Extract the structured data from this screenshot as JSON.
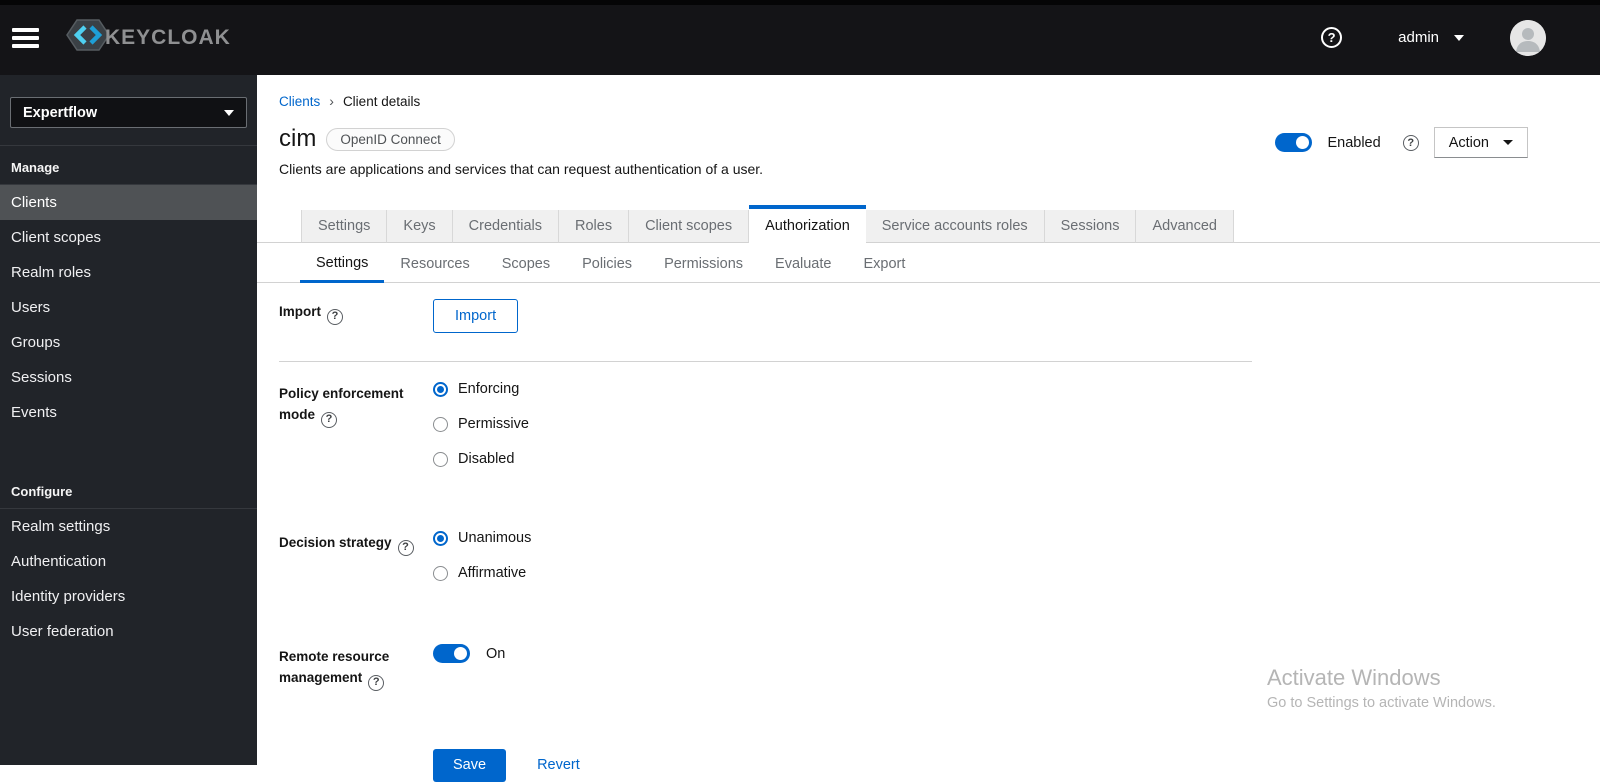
{
  "theme": {
    "accent": "#0066cc",
    "topbar_bg": "#141417",
    "sidebar_bg": "#212429",
    "sidebar_selected_bg": "#4f5255",
    "tab_inactive_bg": "#f0f0f0",
    "logo_cyan": "#4fd0f0",
    "logo_blue": "#1e9fd6"
  },
  "topbar": {
    "brand": "KEYCLOAK",
    "user": "admin"
  },
  "sidebar": {
    "realm_selector": {
      "value": "Expertflow"
    },
    "sections": [
      {
        "title": "Manage",
        "items": [
          {
            "label": "Clients",
            "active": true
          },
          {
            "label": "Client scopes",
            "active": false
          },
          {
            "label": "Realm roles",
            "active": false
          },
          {
            "label": "Users",
            "active": false
          },
          {
            "label": "Groups",
            "active": false
          },
          {
            "label": "Sessions",
            "active": false
          },
          {
            "label": "Events",
            "active": false
          }
        ]
      },
      {
        "title": "Configure",
        "items": [
          {
            "label": "Realm settings",
            "active": false
          },
          {
            "label": "Authentication",
            "active": false
          },
          {
            "label": "Identity providers",
            "active": false
          },
          {
            "label": "User federation",
            "active": false
          }
        ]
      }
    ]
  },
  "breadcrumb": {
    "items": [
      {
        "label": "Clients"
      },
      {
        "label": "Client details"
      }
    ]
  },
  "header": {
    "title": "cim",
    "badge": "OpenID Connect",
    "description": "Clients are applications and services that can request authentication of a user.",
    "enabled_label": "Enabled",
    "enabled_state": "on",
    "action_button": "Action"
  },
  "tabs": {
    "items": [
      {
        "label": "Settings",
        "active": false
      },
      {
        "label": "Keys",
        "active": false
      },
      {
        "label": "Credentials",
        "active": false
      },
      {
        "label": "Roles",
        "active": false
      },
      {
        "label": "Client scopes",
        "active": false
      },
      {
        "label": "Authorization",
        "active": true
      },
      {
        "label": "Service accounts roles",
        "active": false
      },
      {
        "label": "Sessions",
        "active": false
      },
      {
        "label": "Advanced",
        "active": false
      }
    ]
  },
  "subtabs": {
    "items": [
      {
        "label": "Settings",
        "active": true
      },
      {
        "label": "Resources",
        "active": false
      },
      {
        "label": "Scopes",
        "active": false
      },
      {
        "label": "Policies",
        "active": false
      },
      {
        "label": "Permissions",
        "active": false
      },
      {
        "label": "Evaluate",
        "active": false
      },
      {
        "label": "Export",
        "active": false
      }
    ]
  },
  "form": {
    "import": {
      "label": "Import",
      "button_label": "Import"
    },
    "policy_enforcement_mode": {
      "label": "Policy enforcement mode",
      "selected": "Enforcing",
      "options": [
        {
          "label": "Enforcing",
          "selected": true
        },
        {
          "label": "Permissive",
          "selected": false
        },
        {
          "label": "Disabled",
          "selected": false
        }
      ]
    },
    "decision_strategy": {
      "label": "Decision strategy",
      "selected": "Unanimous",
      "options": [
        {
          "label": "Unanimous",
          "selected": true
        },
        {
          "label": "Affirmative",
          "selected": false
        }
      ]
    },
    "remote_resource_management": {
      "label": "Remote resource management",
      "state": "On"
    },
    "save_button": "Save",
    "revert_button": "Revert"
  },
  "watermark": {
    "title": "Activate Windows",
    "subtitle": "Go to Settings to activate Windows."
  }
}
